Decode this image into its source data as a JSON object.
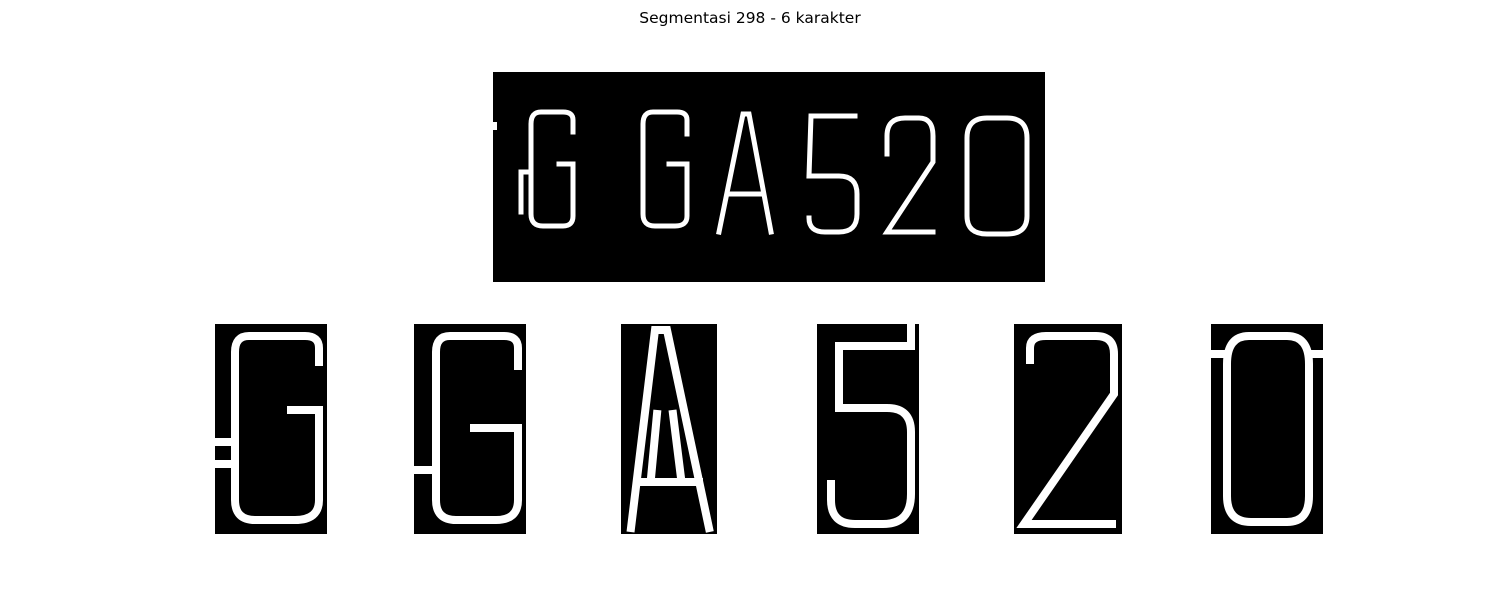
{
  "figure": {
    "title": "Segmentasi 298 - 6 karakter"
  },
  "plate": {
    "characters": [
      "G",
      "G",
      "A",
      "5",
      "2",
      "0"
    ]
  },
  "segments": [
    {
      "character": "G"
    },
    {
      "character": "G"
    },
    {
      "character": "A"
    },
    {
      "character": "5"
    },
    {
      "character": "2"
    },
    {
      "character": "0"
    }
  ],
  "colors": {
    "background": "#ffffff",
    "image_background": "#000000",
    "image_foreground": "#ffffff"
  }
}
